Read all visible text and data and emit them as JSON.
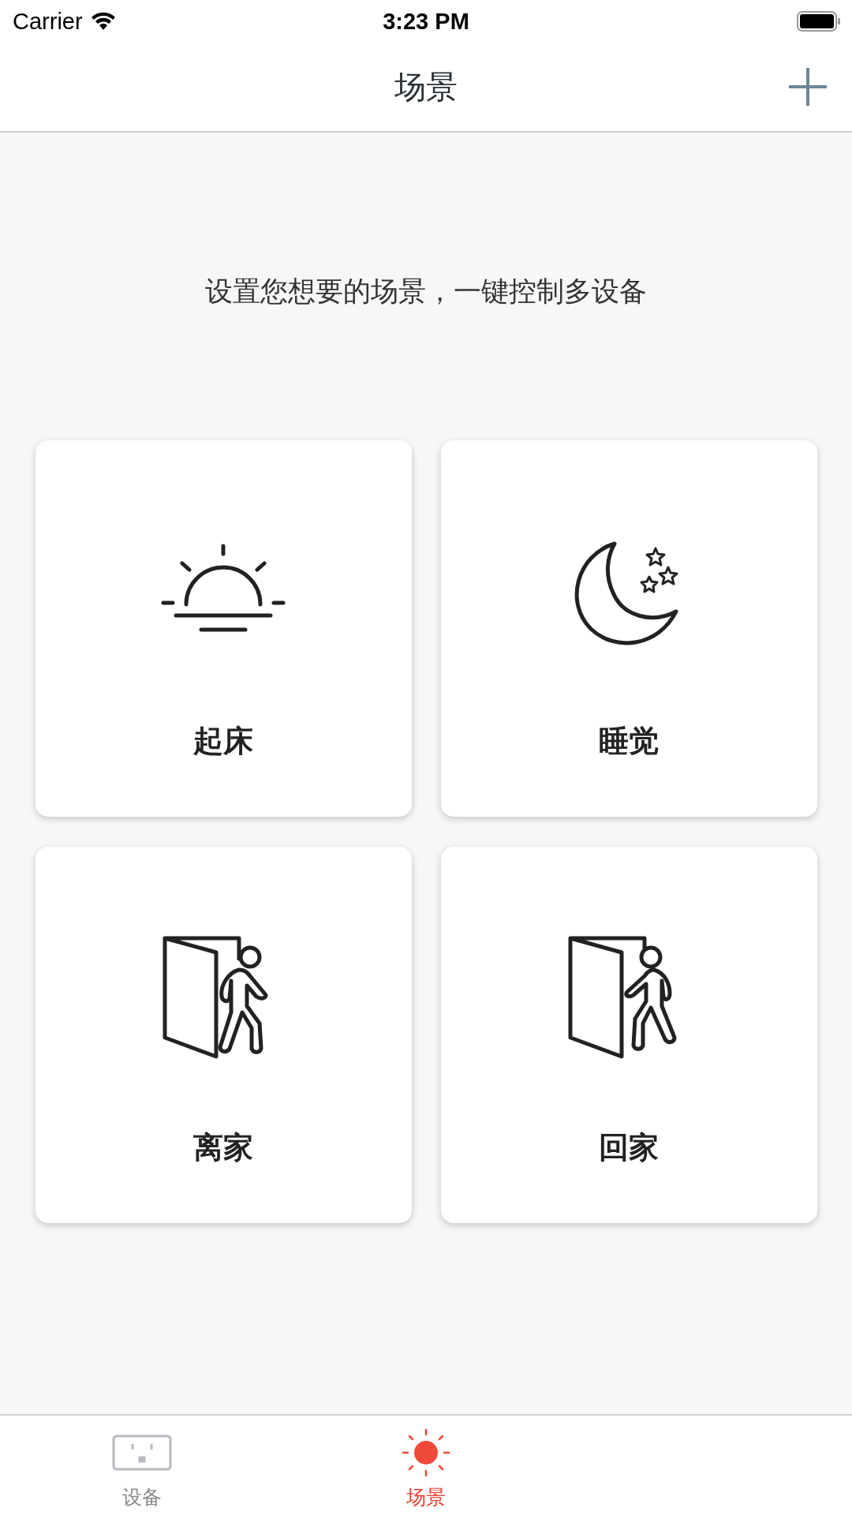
{
  "status_bar": {
    "carrier": "Carrier",
    "time": "3:23 PM"
  },
  "nav_bar": {
    "title": "场景"
  },
  "subtitle": "设置您想要的场景，一键控制多设备",
  "scenes": [
    {
      "kind": "sunrise",
      "label": "起床"
    },
    {
      "kind": "moon",
      "label": "睡觉"
    },
    {
      "kind": "leave",
      "label": "离家"
    },
    {
      "kind": "return",
      "label": "回家"
    }
  ],
  "tabs": [
    {
      "kind": "outlet",
      "label": "设备",
      "selected": false
    },
    {
      "kind": "sun",
      "label": "场景",
      "selected": true
    }
  ]
}
